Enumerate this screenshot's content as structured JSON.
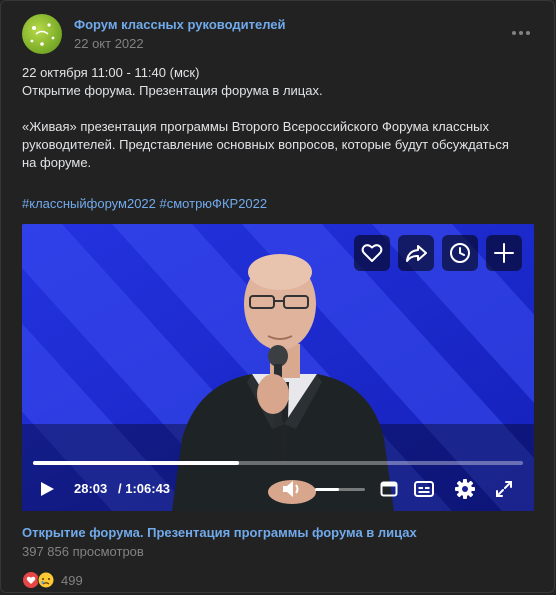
{
  "post": {
    "group_name": "Форум классных руководителей",
    "date": "22 окт 2022",
    "more_icon": "more-dots-icon",
    "text_lines": [
      "22 октября 11:00 - 11:40 (мск)",
      "Открытие форума. Презентация форума в лицах.",
      "«Живая» презентация программы Второго Всероссийского Форума классных",
      "руководителей. Представление основных вопросов, которые будут обсуждаться",
      "на форуме."
    ],
    "hashtags": [
      "#классныйфорум2022",
      "#смотрюФКР2022"
    ]
  },
  "video": {
    "overlay_buttons": [
      "heart-icon",
      "share-icon",
      "clock-icon",
      "plus-icon"
    ],
    "current_time": "28:03",
    "total_time": "/ 1:06:43",
    "progress": 0.42,
    "volume": 0.48,
    "controls": [
      "play-icon",
      "volume-icon",
      "miniplayer-icon",
      "subtitles-icon",
      "settings-icon",
      "fullscreen-icon"
    ],
    "title": "Открытие форума. Презентация программы форума в лицах",
    "views": "397 856 просмотров"
  },
  "reactions": {
    "icons": [
      "heart-reaction-icon",
      "sad-reaction-icon"
    ],
    "count": "499"
  },
  "colors": {
    "background": "#222222",
    "link": "#71aaeb",
    "text": "#e1e3e6",
    "muted": "#828282",
    "video_bg": "#1d2fd6"
  }
}
